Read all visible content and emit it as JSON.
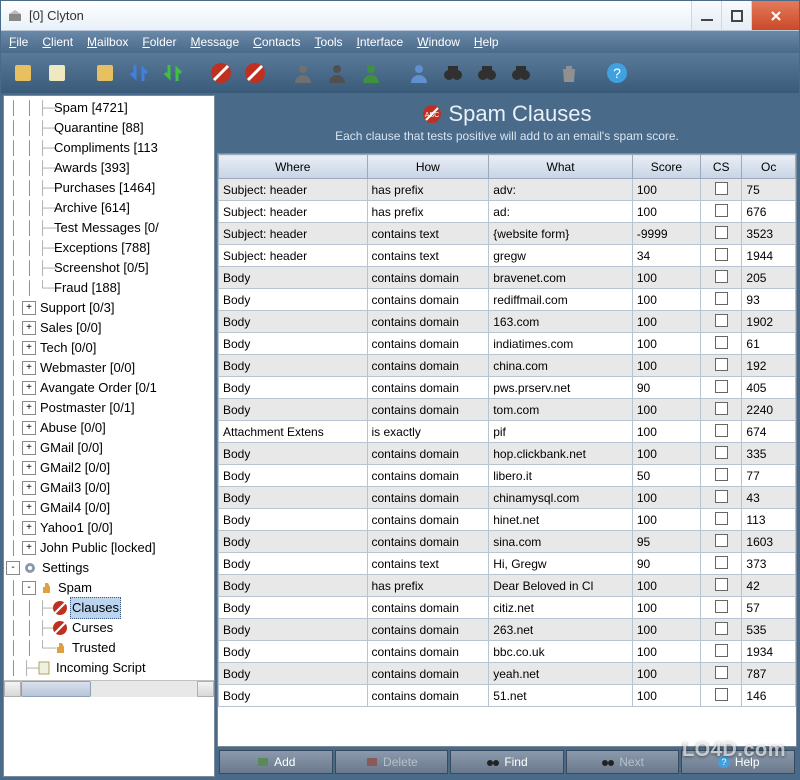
{
  "window": {
    "title": "[0] Clyton"
  },
  "menu": [
    "File",
    "Client",
    "Mailbox",
    "Folder",
    "Message",
    "Contacts",
    "Tools",
    "Interface",
    "Window",
    "Help"
  ],
  "toolbar_icons": [
    "compose-icon",
    "notes-icon",
    "folder-new-icon",
    "sync-down-icon",
    "sync-up-icon",
    "forbid-icon",
    "abc-forbid-icon",
    "user-icon",
    "user-shadow-icon",
    "user-green-icon",
    "group-add-icon",
    "binoculars-icon",
    "binoculars-icon",
    "binoculars-back-icon",
    "trash-icon",
    "help-icon"
  ],
  "tree": [
    {
      "indent": 2,
      "exp": null,
      "branch": "├",
      "label": "Spam [4721]"
    },
    {
      "indent": 2,
      "exp": null,
      "branch": "├",
      "label": "Quarantine [88]"
    },
    {
      "indent": 2,
      "exp": null,
      "branch": "├",
      "label": "Compliments [113"
    },
    {
      "indent": 2,
      "exp": null,
      "branch": "├",
      "label": "Awards [393]"
    },
    {
      "indent": 2,
      "exp": null,
      "branch": "├",
      "label": "Purchases [1464]"
    },
    {
      "indent": 2,
      "exp": null,
      "branch": "├",
      "label": "Archive [614]"
    },
    {
      "indent": 2,
      "exp": null,
      "branch": "├",
      "label": "Test Messages [0/"
    },
    {
      "indent": 2,
      "exp": null,
      "branch": "├",
      "label": "Exceptions [788]"
    },
    {
      "indent": 2,
      "exp": null,
      "branch": "├",
      "label": "Screenshot [0/5]"
    },
    {
      "indent": 2,
      "exp": null,
      "branch": "└",
      "label": "Fraud [188]"
    },
    {
      "indent": 1,
      "exp": "+",
      "label": "Support [0/3]"
    },
    {
      "indent": 1,
      "exp": "+",
      "label": "Sales [0/0]"
    },
    {
      "indent": 1,
      "exp": "+",
      "label": "Tech [0/0]"
    },
    {
      "indent": 1,
      "exp": "+",
      "label": "Webmaster [0/0]"
    },
    {
      "indent": 1,
      "exp": "+",
      "label": "Avangate Order [0/1"
    },
    {
      "indent": 1,
      "exp": "+",
      "label": "Postmaster [0/1]"
    },
    {
      "indent": 1,
      "exp": "+",
      "label": "Abuse [0/0]"
    },
    {
      "indent": 1,
      "exp": "+",
      "label": "GMail [0/0]"
    },
    {
      "indent": 1,
      "exp": "+",
      "label": "GMail2 [0/0]"
    },
    {
      "indent": 1,
      "exp": "+",
      "label": "GMail3 [0/0]"
    },
    {
      "indent": 1,
      "exp": "+",
      "label": "GMail4 [0/0]"
    },
    {
      "indent": 1,
      "exp": "+",
      "label": "Yahoo1 [0/0]"
    },
    {
      "indent": 1,
      "exp": "+",
      "label": "John Public [locked]"
    },
    {
      "indent": 0,
      "exp": "-",
      "icon": "gear",
      "label": "Settings"
    },
    {
      "indent": 1,
      "exp": "-",
      "icon": "thumb",
      "label": "Spam"
    },
    {
      "indent": 2,
      "exp": null,
      "branch": "├",
      "icon": "forbid",
      "label": "Clauses",
      "selected": true
    },
    {
      "indent": 2,
      "exp": null,
      "branch": "├",
      "icon": "forbid",
      "label": "Curses"
    },
    {
      "indent": 2,
      "exp": null,
      "branch": "└",
      "icon": "thumb",
      "label": "Trusted"
    },
    {
      "indent": 1,
      "exp": null,
      "branch": "├",
      "icon": "script",
      "label": "Incoming Script"
    }
  ],
  "panel": {
    "title": "Spam Clauses",
    "subtitle": "Each clause that tests positive will add to an email's spam score."
  },
  "columns": [
    "Where",
    "How",
    "What",
    "Score",
    "CS",
    "Oc"
  ],
  "col_widths": [
    "122",
    "100",
    "118",
    "56",
    "34",
    "44"
  ],
  "rows": [
    {
      "where": "Subject: header",
      "how": "has prefix",
      "what": "adv:",
      "score": "100",
      "cs": false,
      "oc": "75"
    },
    {
      "where": "Subject: header",
      "how": "has prefix",
      "what": "ad:",
      "score": "100",
      "cs": false,
      "oc": "676"
    },
    {
      "where": "Subject: header",
      "how": "contains text",
      "what": "{website form}",
      "score": "-9999",
      "cs": false,
      "oc": "3523"
    },
    {
      "where": "Subject: header",
      "how": "contains text",
      "what": "gregw",
      "score": "34",
      "cs": false,
      "oc": "1944"
    },
    {
      "where": "Body",
      "how": "contains domain",
      "what": "bravenet.com",
      "score": "100",
      "cs": false,
      "oc": "205"
    },
    {
      "where": "Body",
      "how": "contains domain",
      "what": "rediffmail.com",
      "score": "100",
      "cs": false,
      "oc": "93"
    },
    {
      "where": "Body",
      "how": "contains domain",
      "what": "163.com",
      "score": "100",
      "cs": false,
      "oc": "1902"
    },
    {
      "where": "Body",
      "how": "contains domain",
      "what": "indiatimes.com",
      "score": "100",
      "cs": false,
      "oc": "61"
    },
    {
      "where": "Body",
      "how": "contains domain",
      "what": "china.com",
      "score": "100",
      "cs": false,
      "oc": "192"
    },
    {
      "where": "Body",
      "how": "contains domain",
      "what": "pws.prserv.net",
      "score": "90",
      "cs": false,
      "oc": "405"
    },
    {
      "where": "Body",
      "how": "contains domain",
      "what": "tom.com",
      "score": "100",
      "cs": false,
      "oc": "2240"
    },
    {
      "where": "Attachment Extens",
      "how": "is exactly",
      "what": "pif",
      "score": "100",
      "cs": false,
      "oc": "674"
    },
    {
      "where": "Body",
      "how": "contains domain",
      "what": "hop.clickbank.net",
      "score": "100",
      "cs": false,
      "oc": "335"
    },
    {
      "where": "Body",
      "how": "contains domain",
      "what": "libero.it",
      "score": "50",
      "cs": false,
      "oc": "77"
    },
    {
      "where": "Body",
      "how": "contains domain",
      "what": "chinamysql.com",
      "score": "100",
      "cs": false,
      "oc": "43"
    },
    {
      "where": "Body",
      "how": "contains domain",
      "what": "hinet.net",
      "score": "100",
      "cs": false,
      "oc": "113"
    },
    {
      "where": "Body",
      "how": "contains domain",
      "what": "sina.com",
      "score": "95",
      "cs": false,
      "oc": "1603"
    },
    {
      "where": "Body",
      "how": "contains text",
      "what": "Hi, Gregw",
      "score": "90",
      "cs": false,
      "oc": "373"
    },
    {
      "where": "Body",
      "how": "has prefix",
      "what": "Dear Beloved in Cl",
      "score": "100",
      "cs": false,
      "oc": "42"
    },
    {
      "where": "Body",
      "how": "contains domain",
      "what": "citiz.net",
      "score": "100",
      "cs": false,
      "oc": "57"
    },
    {
      "where": "Body",
      "how": "contains domain",
      "what": "263.net",
      "score": "100",
      "cs": false,
      "oc": "535"
    },
    {
      "where": "Body",
      "how": "contains domain",
      "what": "bbc.co.uk",
      "score": "100",
      "cs": false,
      "oc": "1934"
    },
    {
      "where": "Body",
      "how": "contains domain",
      "what": "yeah.net",
      "score": "100",
      "cs": false,
      "oc": "787"
    },
    {
      "where": "Body",
      "how": "contains domain",
      "what": "51.net",
      "score": "100",
      "cs": false,
      "oc": "146"
    }
  ],
  "buttons": [
    {
      "icon": "plus",
      "label": "Add",
      "enabled": true
    },
    {
      "icon": "minus",
      "label": "Delete",
      "enabled": false
    },
    {
      "icon": "binoculars",
      "label": "Find",
      "enabled": true
    },
    {
      "icon": "binoculars",
      "label": "Next",
      "enabled": false
    },
    {
      "icon": "help",
      "label": "Help",
      "enabled": true
    }
  ],
  "watermark": "LO4D.com"
}
